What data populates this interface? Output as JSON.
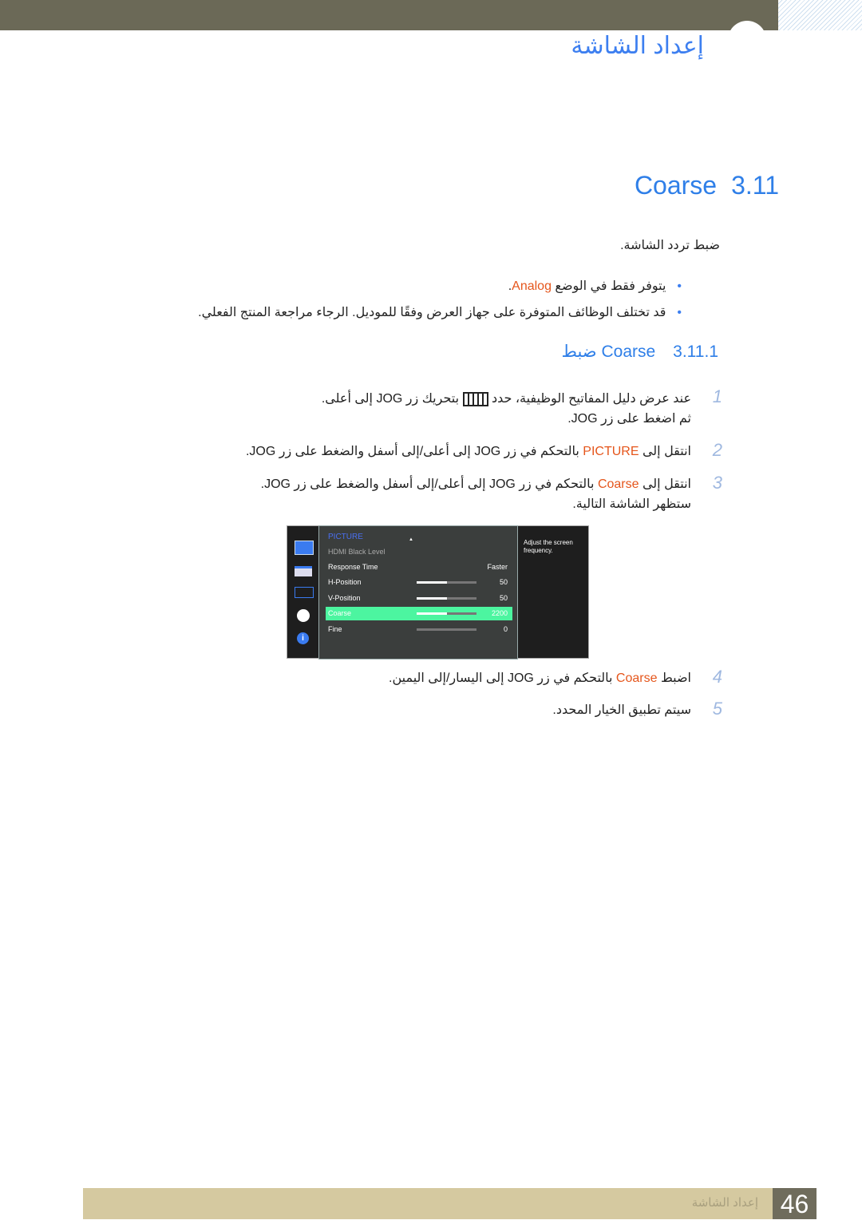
{
  "chapter_title": "إعداد الشاشة",
  "section": {
    "number": "3.11",
    "title": "Coarse"
  },
  "intro": "ضبط تردد الشاشة.",
  "bullets": [
    {
      "pre": "يتوفر فقط في الوضع ",
      "hl": "Analog",
      "post": "."
    },
    {
      "text": "قد تختلف الوظائف المتوفرة على جهاز العرض وفقًا للموديل. الرجاء مراجعة المنتج الفعلي."
    }
  ],
  "subsection": {
    "number": "3.11.1",
    "title": "ضبط Coarse"
  },
  "steps": [
    {
      "n": "1",
      "pre": "عند عرض دليل المفاتيح الوظيفية، حدد ",
      "post": " بتحريك زر JOG إلى أعلى.",
      "line2": "ثم اضغط على زر JOG."
    },
    {
      "n": "2",
      "pre": "انتقل إلى ",
      "hl": "PICTURE",
      "post": " بالتحكم في زر JOG إلى أعلى/إلى أسفل والضغط على زر JOG."
    },
    {
      "n": "3",
      "pre": "انتقل إلى ",
      "hl": "Coarse",
      "post": " بالتحكم في زر JOG إلى أعلى/إلى أسفل والضغط على زر JOG.",
      "line2": "ستظهر الشاشة التالية."
    },
    {
      "n": "4",
      "pre": "اضبط ",
      "hl": "Coarse",
      "post": " بالتحكم في زر JOG إلى اليسار/إلى اليمين."
    },
    {
      "n": "5",
      "text": "سيتم تطبيق الخيار المحدد."
    }
  ],
  "osd": {
    "menu_title": "PICTURE",
    "rows": [
      {
        "label": "HDMI Black Level",
        "value": ""
      },
      {
        "label": "Response Time",
        "value": "Faster"
      },
      {
        "label": "H-Position",
        "value": "50",
        "fill": 50
      },
      {
        "label": "V-Position",
        "value": "50",
        "fill": 50
      },
      {
        "label": "Coarse",
        "value": "2200",
        "fill": 50,
        "selected": true
      },
      {
        "label": "Fine",
        "value": "0",
        "fill": 0
      }
    ],
    "help": "Adjust the screen frequency.",
    "highlight_color": "#4cf5a0"
  },
  "footer": {
    "title": "إعداد الشاشة",
    "page": "46"
  }
}
